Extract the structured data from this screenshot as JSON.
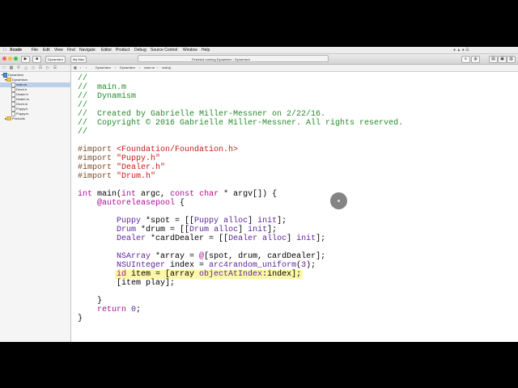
{
  "menubar": {
    "items": [
      "Xcode",
      "File",
      "Edit",
      "View",
      "Find",
      "Navigate",
      "Editor",
      "Product",
      "Debug",
      "Source Control",
      "Window",
      "Help"
    ]
  },
  "toolbar": {
    "scheme": "Dynamism",
    "destination": "My Mac",
    "status": "Finished running Dynamism : Dynamism"
  },
  "navigator": {
    "items": [
      {
        "label": "Dynamism",
        "kind": "project"
      },
      {
        "label": "Dynamism",
        "kind": "folder"
      },
      {
        "label": "main.m",
        "kind": "file",
        "selected": true
      },
      {
        "label": "Drum.h",
        "kind": "file"
      },
      {
        "label": "Dealer.h",
        "kind": "file"
      },
      {
        "label": "Dealer.m",
        "kind": "file"
      },
      {
        "label": "Drum.m",
        "kind": "file"
      },
      {
        "label": "Puppy.h",
        "kind": "file"
      },
      {
        "label": "Puppy.m",
        "kind": "file"
      },
      {
        "label": "Products",
        "kind": "folder"
      }
    ]
  },
  "jumpbar": {
    "crumbs": [
      "Dynamism",
      "Dynamism",
      "main.m",
      "main()"
    ]
  },
  "code": {
    "lines": [
      [
        [
          "c-comment",
          "//"
        ]
      ],
      [
        [
          "c-comment",
          "//  main.m"
        ]
      ],
      [
        [
          "c-comment",
          "//  Dynamism"
        ]
      ],
      [
        [
          "c-comment",
          "//"
        ]
      ],
      [
        [
          "c-comment",
          "//  Created by Gabrielle Miller-Messner on 2/22/16."
        ]
      ],
      [
        [
          "c-comment",
          "//  Copyright © 2016 Gabrielle Miller-Messner. All rights reserved."
        ]
      ],
      [
        [
          "c-comment",
          "//"
        ]
      ],
      [],
      [
        [
          "c-pre",
          "#import "
        ],
        [
          "c-str",
          "<Foundation/Foundation.h>"
        ]
      ],
      [
        [
          "c-pre",
          "#import "
        ],
        [
          "c-str",
          "\"Puppy.h\""
        ]
      ],
      [
        [
          "c-pre",
          "#import "
        ],
        [
          "c-str",
          "\"Dealer.h\""
        ]
      ],
      [
        [
          "c-pre",
          "#import "
        ],
        [
          "c-str",
          "\"Drum.h\""
        ]
      ],
      [],
      [
        [
          "c-kw",
          "int"
        ],
        [
          "c-plain",
          " main("
        ],
        [
          "c-kw",
          "int"
        ],
        [
          "c-plain",
          " argc, "
        ],
        [
          "c-kw",
          "const char"
        ],
        [
          "c-plain",
          " * argv[]) {"
        ]
      ],
      [
        [
          "c-plain",
          "    "
        ],
        [
          "c-at",
          "@autoreleasepool"
        ],
        [
          "c-plain",
          " {"
        ]
      ],
      [],
      [
        [
          "c-plain",
          "        "
        ],
        [
          "c-type",
          "Puppy"
        ],
        [
          "c-plain",
          " *spot = [["
        ],
        [
          "c-type",
          "Puppy"
        ],
        [
          "c-plain",
          " "
        ],
        [
          "c-type",
          "alloc"
        ],
        [
          "c-plain",
          "] "
        ],
        [
          "c-type",
          "init"
        ],
        [
          "c-plain",
          "];"
        ]
      ],
      [
        [
          "c-plain",
          "        "
        ],
        [
          "c-type",
          "Drum"
        ],
        [
          "c-plain",
          " *drum = [["
        ],
        [
          "c-type",
          "Drum"
        ],
        [
          "c-plain",
          " "
        ],
        [
          "c-type",
          "alloc"
        ],
        [
          "c-plain",
          "] "
        ],
        [
          "c-type",
          "init"
        ],
        [
          "c-plain",
          "];"
        ]
      ],
      [
        [
          "c-plain",
          "        "
        ],
        [
          "c-type",
          "Dealer"
        ],
        [
          "c-plain",
          " *cardDealer = [["
        ],
        [
          "c-type",
          "Dealer"
        ],
        [
          "c-plain",
          " "
        ],
        [
          "c-type",
          "alloc"
        ],
        [
          "c-plain",
          "] "
        ],
        [
          "c-type",
          "init"
        ],
        [
          "c-plain",
          "];"
        ]
      ],
      [],
      [
        [
          "c-plain",
          "        "
        ],
        [
          "c-type",
          "NSArray"
        ],
        [
          "c-plain",
          " *array = "
        ],
        [
          "c-at",
          "@"
        ],
        [
          "c-plain",
          "[spot, drum, cardDealer];"
        ]
      ],
      [
        [
          "c-plain",
          "        "
        ],
        [
          "c-type",
          "NSUInteger"
        ],
        [
          "c-plain",
          " index = "
        ],
        [
          "c-type",
          "arc4random_uniform"
        ],
        [
          "c-plain",
          "("
        ],
        [
          "c-type",
          "3"
        ],
        [
          "c-plain",
          ");"
        ]
      ],
      [
        [
          "c-plain",
          "        "
        ],
        [
          "c-kw",
          "id"
        ],
        [
          "c-plain",
          " item = [array "
        ],
        [
          "c-type",
          "objectAtIndex"
        ],
        [
          "c-plain",
          ":index];"
        ]
      ],
      [
        [
          "c-plain",
          "        [item play];"
        ]
      ],
      [],
      [
        [
          "c-plain",
          "    }"
        ]
      ],
      [
        [
          "c-plain",
          "    "
        ],
        [
          "c-kw",
          "return"
        ],
        [
          "c-plain",
          " "
        ],
        [
          "c-type",
          "0"
        ],
        [
          "c-plain",
          ";"
        ]
      ],
      [
        [
          "c-plain",
          "}"
        ]
      ]
    ],
    "highlighted_lines": [
      22,
      23
    ],
    "highlight_color": "#fdf8a8"
  }
}
